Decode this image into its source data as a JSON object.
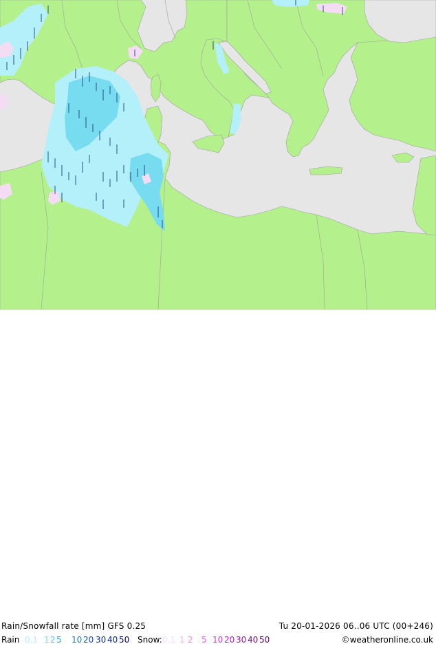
{
  "title": "Rain/Snowfall rate [mm] GFS 0.25",
  "valid_time": "Tu 20-01-2026 06..06 UTC (00+246)",
  "legend": {
    "rain_label": "Rain",
    "rain_values": [
      {
        "text": "0.1",
        "color": "#b4f0fa"
      },
      {
        "text": "1",
        "color": "#78dcf0"
      },
      {
        "text": "2",
        "color": "#50c8e6"
      },
      {
        "text": "5",
        "color": "#32a0dc"
      },
      {
        "text": "10",
        "color": "#1e78c8"
      },
      {
        "text": "20",
        "color": "#1450b4"
      },
      {
        "text": "30",
        "color": "#0a3296"
      },
      {
        "text": "40",
        "color": "#051e78"
      },
      {
        "text": "50",
        "color": "#000a5a"
      }
    ],
    "snow_label": "Snow:",
    "snow_values": [
      {
        "text": "0.1",
        "color": "#f5dcf5"
      },
      {
        "text": "1",
        "color": "#f0b4f0"
      },
      {
        "text": "2",
        "color": "#e68ce6"
      },
      {
        "text": "5",
        "color": "#dc64dc"
      },
      {
        "text": "10",
        "color": "#c83cc8"
      },
      {
        "text": "20",
        "color": "#b41eb4"
      },
      {
        "text": "30",
        "color": "#961496"
      },
      {
        "text": "40",
        "color": "#780a78"
      },
      {
        "text": "50",
        "color": "#5a005a"
      }
    ]
  },
  "credit": "©weatheronline.co.uk",
  "colors": {
    "sea": "#e6e6e6",
    "land": "#b4f08c",
    "border": "#a0a0a0",
    "rain_light": "#b4f0fa",
    "rain_mid": "#78dcf0",
    "snow_light": "#f5dcf5"
  }
}
